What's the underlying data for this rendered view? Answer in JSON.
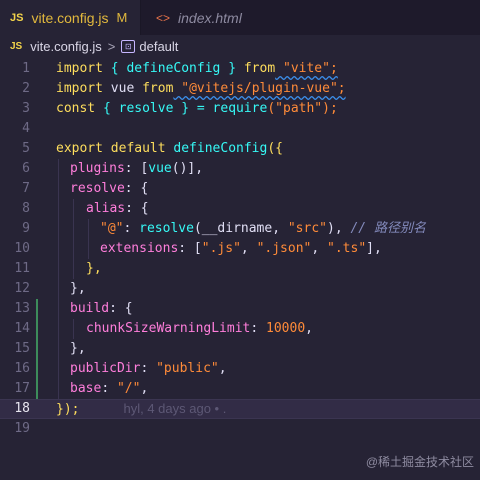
{
  "tabs": [
    {
      "icon": "JS",
      "name": "vite.config.js",
      "modified": "M",
      "close": "✕"
    },
    {
      "icon": "<>",
      "name": "index.html"
    }
  ],
  "breadcrumb": {
    "icon": "JS",
    "file": "vite.config.js",
    "separator": ">",
    "symbol": "default"
  },
  "line_numbers": [
    "1",
    "2",
    "3",
    "4",
    "5",
    "6",
    "7",
    "8",
    "9",
    "10",
    "11",
    "12",
    "13",
    "14",
    "15",
    "16",
    "17",
    "18",
    "19"
  ],
  "code": {
    "l1": {
      "a": "import",
      "b": " { defineConfig } ",
      "c": "from",
      "d": " \"vite\";"
    },
    "l2": {
      "a": "import",
      "b": " vue ",
      "c": "from",
      "d": " \"@vitejs/plugin-vue\";"
    },
    "l3": {
      "a": "const",
      "b": " { resolve } = ",
      "c": "require",
      "d": "(\"path\");"
    },
    "l5": {
      "a": "export default",
      "b": " defineConfig",
      "c": "({"
    },
    "l6": {
      "a": "plugins",
      "b": ": [",
      "c": "vue",
      "d": "()],"
    },
    "l7": {
      "a": "resolve",
      "b": ": {"
    },
    "l8": {
      "a": "alias",
      "b": ": {"
    },
    "l9": {
      "a": "\"@\"",
      "b": ": ",
      "c": "resolve",
      "d": "(__dirname, ",
      "e": "\"src\"",
      "f": "), ",
      "g": "// 路径别名"
    },
    "l10": {
      "a": "extensions",
      "b": ": [",
      "c": "\".js\"",
      "d": ", ",
      "e": "\".json\"",
      "f": ", ",
      "g": "\".ts\"",
      "h": "],"
    },
    "l11": {
      "a": "},"
    },
    "l12": {
      "a": "},"
    },
    "l13": {
      "a": "build",
      "b": ": {"
    },
    "l14": {
      "a": "chunkSizeWarningLimit",
      "b": ": ",
      "c": "10000",
      "d": ","
    },
    "l15": {
      "a": "},"
    },
    "l16": {
      "a": "publicDir",
      "b": ": ",
      "c": "\"public\"",
      "d": ","
    },
    "l17": {
      "a": "base",
      "b": ": ",
      "c": "\"/\"",
      "d": ","
    },
    "l18": {
      "a": "});"
    }
  },
  "blame": "hyl, 4 days ago • .",
  "watermark": "@稀土掘金技术社区",
  "colors": {
    "background": "#262335",
    "keyword": "#fede5d",
    "string": "#ff8b39",
    "function": "#36f9f6",
    "property": "#ff7edb",
    "comment": "#848bbd"
  }
}
